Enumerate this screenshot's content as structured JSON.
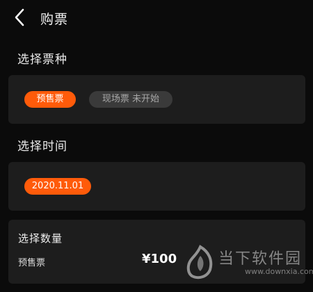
{
  "header": {
    "title": "购票"
  },
  "ticket_type": {
    "label": "选择票种",
    "options": [
      {
        "label": "预售票"
      },
      {
        "label": "现场票 未开始"
      }
    ]
  },
  "time": {
    "label": "选择时间",
    "options": [
      {
        "label": "2020.11.01"
      }
    ]
  },
  "quantity": {
    "label": "选择数量",
    "ticket_name": "预售票",
    "price": "¥100"
  },
  "watermark": {
    "brand": "当下软件园",
    "url": "www.downxia.com"
  },
  "colors": {
    "accent": "#ff5b0a",
    "card": "#1d1d1d",
    "background": "#0b0b0b",
    "disabled_chip": "#3a3a3a"
  },
  "icons": {
    "back": "chevron-left-icon",
    "logo": "downxia-logo-icon"
  }
}
